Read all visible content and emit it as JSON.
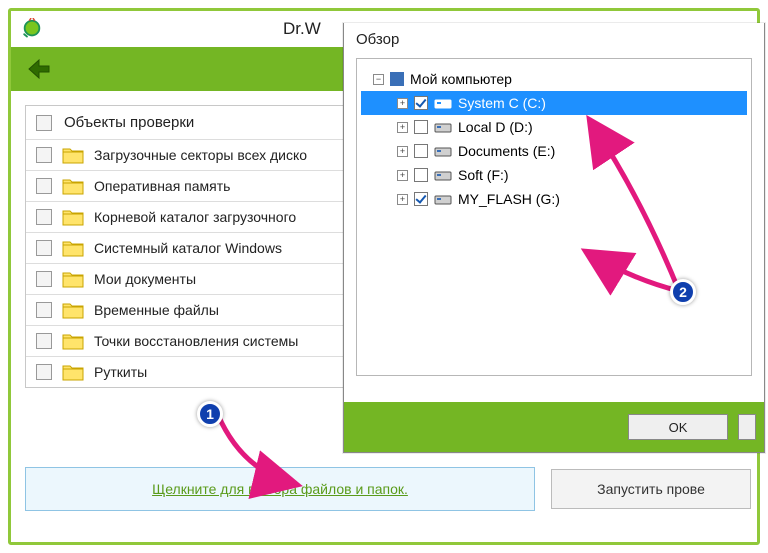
{
  "app": {
    "title": "Dr.W"
  },
  "scan": {
    "header": "Объекты проверки",
    "items": [
      {
        "label": "Загрузочные секторы всех диско"
      },
      {
        "label": "Оперативная память"
      },
      {
        "label": "Корневой каталог загрузочного"
      },
      {
        "label": "Системный каталог Windows"
      },
      {
        "label": "Мои документы"
      },
      {
        "label": "Временные файлы"
      },
      {
        "label": "Точки восстановления системы"
      },
      {
        "label": "Руткиты"
      }
    ],
    "select_files_link": "Щелкните для выбора файлов и папок.",
    "start_button": "Запустить прове"
  },
  "browse": {
    "title": "Обзор",
    "root": "Мой компьютер",
    "drives": [
      {
        "label": "System C (C:)",
        "checked": true,
        "selected": true
      },
      {
        "label": "Local D (D:)",
        "checked": false,
        "selected": false
      },
      {
        "label": "Documents (E:)",
        "checked": false,
        "selected": false
      },
      {
        "label": "Soft (F:)",
        "checked": false,
        "selected": false
      },
      {
        "label": "MY_FLASH (G:)",
        "checked": true,
        "selected": false
      }
    ],
    "ok": "OK"
  },
  "badges": {
    "b1": "1",
    "b2": "2"
  }
}
